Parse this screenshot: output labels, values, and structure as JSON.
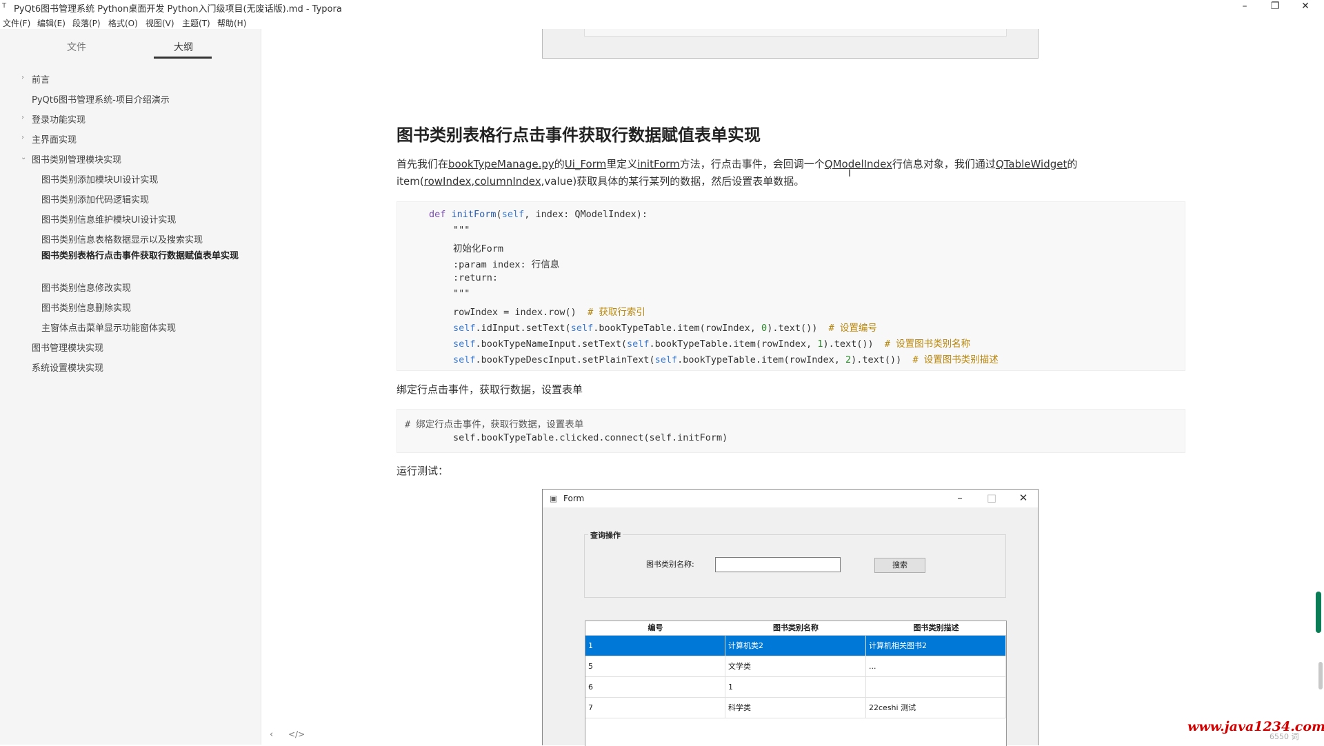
{
  "window": {
    "title": "PyQt6图书管理系统 Python桌面开发 Python入门级项目(无废话版).md - Typora",
    "controls": {
      "minimize": "–",
      "maximize": "❐",
      "close": "✕"
    }
  },
  "menubar": [
    "文件(F)",
    "编辑(E)",
    "段落(P)",
    "格式(O)",
    "视图(V)",
    "主题(T)",
    "帮助(H)"
  ],
  "sidebar": {
    "tabs": [
      "文件",
      "大纲"
    ],
    "active_tab": "大纲",
    "outline": [
      "前言",
      "PyQt6图书管理系统-项目介绍演示",
      "登录功能实现",
      "主界面实现",
      "图书类别管理模块实现",
      "图书类别添加模块UI设计实现",
      "图书类别添加代码逻辑实现",
      "图书类别信息维护模块UI设计实现",
      "图书类别信息表格数据显示以及搜索实现",
      "图书类别表格行点击事件获取行数据赋值表单实现",
      "图书类别信息修改实现",
      "图书类别信息删除实现",
      "主窗体点击菜单显示功能窗体实现",
      "图书管理模块实现",
      "系统设置模块实现"
    ],
    "bottom_icons": [
      "‹",
      "</>"
    ]
  },
  "doc": {
    "heading": "图书类别表格行点击事件获取行数据赋值表单实现",
    "para1_parts": [
      "首先我们在",
      "bookTypeManage.py",
      "的",
      "Ui_Form",
      "里定义",
      "initForm",
      "方法，行点击事件，会回调一个",
      "QModelIndex",
      "行信息对象，我们通过",
      "QTableWidget",
      "的"
    ],
    "para1_line2_parts": [
      "item(",
      "rowIndex",
      ",",
      "columnIndex",
      ",value)获取具体的某行某列的数据，然后设置表单数据。"
    ],
    "code1": {
      "l1": [
        "def ",
        "initForm",
        "(",
        "self",
        ", index: QModelIndex):"
      ],
      "l2": "\"\"\"",
      "l3": "初始化Form",
      "l4": ":param index: 行信息",
      "l5": ":return:",
      "l6": "\"\"\"",
      "l7": [
        "rowIndex = index.row()  ",
        "# 获取行索引"
      ],
      "l8": [
        "self",
        ".idInput.setText(",
        "self",
        ".bookTypeTable.item(rowIndex, ",
        "0",
        ").text())  ",
        "# 设置编号"
      ],
      "l9": [
        "self",
        ".bookTypeNameInput.setText(",
        "self",
        ".bookTypeTable.item(rowIndex, ",
        "1",
        ").text())  ",
        "# 设置图书类别名称"
      ],
      "l10": [
        "self",
        ".bookTypeDescInput.setPlainText(",
        "self",
        ".bookTypeTable.item(rowIndex, ",
        "2",
        ").text())  ",
        "# 设置图书类别描述"
      ]
    },
    "para2": "绑定行点击事件，获取行数据，设置表单",
    "code2": {
      "l1": "# 绑定行点击事件，获取行数据，设置表单",
      "l2": "self.bookTypeTable.clicked.connect(self.initForm)"
    },
    "para3": "运行测试："
  },
  "form_window": {
    "title": "Form",
    "controls": {
      "minimize": "–",
      "maximize": "□",
      "close": "✕"
    },
    "group_title": "查询操作",
    "search_label": "图书类别名称:",
    "search_value": "",
    "search_button": "搜索",
    "table": {
      "headers": [
        "编号",
        "图书类别名称",
        "图书类别描述"
      ],
      "rows": [
        [
          "1",
          "计算机类2",
          "计算机相关图书2"
        ],
        [
          "5",
          "文学类",
          "..."
        ],
        [
          "6",
          "1",
          ""
        ],
        [
          "7",
          "科学类",
          "22ceshi 测试"
        ]
      ],
      "selected_row": 0
    }
  },
  "watermark": "www.java1234.com",
  "word_count": "6550 词",
  "colors": {
    "selection": "#0078d7",
    "accent_scroll": "#0a7d57",
    "watermark": "#d40000"
  }
}
